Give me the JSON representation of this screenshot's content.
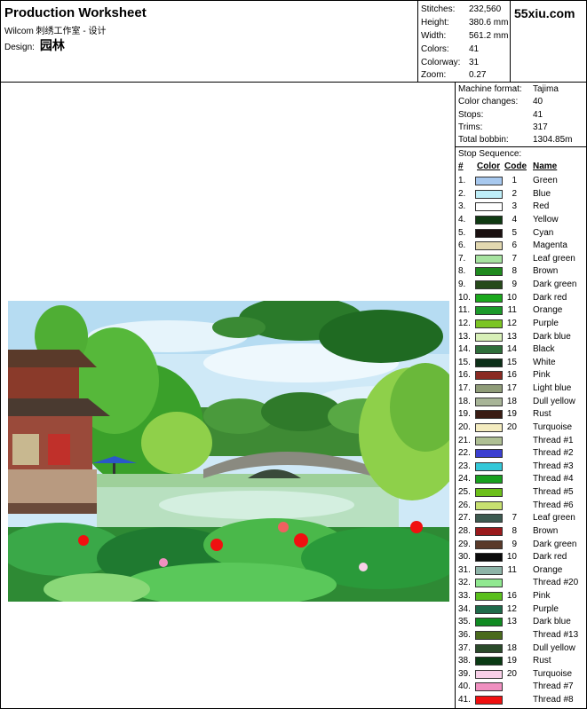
{
  "header": {
    "title": "Production Worksheet",
    "subtitle": "Wilcom 刺绣工作室 - 设计",
    "design_label": "Design:",
    "design_name": "园林",
    "site": "55xiu.com"
  },
  "stats": [
    {
      "label": "Stitches:",
      "value": "232,560"
    },
    {
      "label": "Height:",
      "value": "380.6 mm"
    },
    {
      "label": "Width:",
      "value": "561.2 mm"
    },
    {
      "label": "Colors:",
      "value": "41"
    },
    {
      "label": "Colorway:",
      "value": "31"
    },
    {
      "label": "Zoom:",
      "value": "0.27"
    }
  ],
  "machine": [
    {
      "label": "Machine format:",
      "value": "Tajima"
    },
    {
      "label": "Color changes:",
      "value": "40"
    },
    {
      "label": "Stops:",
      "value": "41"
    },
    {
      "label": "Trims:",
      "value": "317"
    },
    {
      "label": "Total bobbin:",
      "value": "1304.85m"
    }
  ],
  "stop_sequence": {
    "title": "Stop Sequence:",
    "headers": {
      "num": "#",
      "color": "Color",
      "code": "Code",
      "name": "Name"
    },
    "rows": [
      {
        "num": "1.",
        "color": "#a7c8ee",
        "code": "1",
        "name": "Green"
      },
      {
        "num": "2.",
        "color": "#bfeef8",
        "code": "2",
        "name": "Blue"
      },
      {
        "num": "3.",
        "color": "#ffffff",
        "code": "3",
        "name": "Red"
      },
      {
        "num": "4.",
        "color": "#0f3a12",
        "code": "4",
        "name": "Yellow"
      },
      {
        "num": "5.",
        "color": "#1a1010",
        "code": "5",
        "name": "Cyan"
      },
      {
        "num": "6.",
        "color": "#e2d8b0",
        "code": "6",
        "name": "Magenta"
      },
      {
        "num": "7.",
        "color": "#a6e3a0",
        "code": "7",
        "name": "Leaf green"
      },
      {
        "num": "8.",
        "color": "#1f8a1e",
        "code": "8",
        "name": "Brown"
      },
      {
        "num": "9.",
        "color": "#264a1a",
        "code": "9",
        "name": "Dark green"
      },
      {
        "num": "10.",
        "color": "#1aa81c",
        "code": "10",
        "name": "Dark red"
      },
      {
        "num": "11.",
        "color": "#1c9a2a",
        "code": "11",
        "name": "Orange"
      },
      {
        "num": "12.",
        "color": "#7bc423",
        "code": "12",
        "name": "Purple"
      },
      {
        "num": "13.",
        "color": "#d8f0b8",
        "code": "13",
        "name": "Dark blue"
      },
      {
        "num": "14.",
        "color": "#2e6e3a",
        "code": "14",
        "name": "Black"
      },
      {
        "num": "15.",
        "color": "#0c3018",
        "code": "15",
        "name": "White"
      },
      {
        "num": "16.",
        "color": "#8a2a22",
        "code": "16",
        "name": "Pink"
      },
      {
        "num": "17.",
        "color": "#8f9c78",
        "code": "17",
        "name": "Light blue"
      },
      {
        "num": "18.",
        "color": "#a7b497",
        "code": "18",
        "name": "Dull yellow"
      },
      {
        "num": "19.",
        "color": "#3a1c14",
        "code": "19",
        "name": "Rust"
      },
      {
        "num": "20.",
        "color": "#f4ecc0",
        "code": "20",
        "name": "Turquoise"
      },
      {
        "num": "21.",
        "color": "#aebf94",
        "code": "",
        "name": "Thread #1"
      },
      {
        "num": "22.",
        "color": "#3b3fd0",
        "code": "",
        "name": "Thread #2"
      },
      {
        "num": "23.",
        "color": "#34c8d8",
        "code": "",
        "name": "Thread #3"
      },
      {
        "num": "24.",
        "color": "#18a01e",
        "code": "",
        "name": "Thread #4"
      },
      {
        "num": "25.",
        "color": "#6cbf1a",
        "code": "",
        "name": "Thread #5"
      },
      {
        "num": "26.",
        "color": "#c8e070",
        "code": "",
        "name": "Thread #6"
      },
      {
        "num": "27.",
        "color": "#3c5a50",
        "code": "7",
        "name": "Leaf green"
      },
      {
        "num": "28.",
        "color": "#9a1a1c",
        "code": "8",
        "name": "Brown"
      },
      {
        "num": "29.",
        "color": "#5a3a2a",
        "code": "9",
        "name": "Dark green"
      },
      {
        "num": "30.",
        "color": "#0a0a0a",
        "code": "10",
        "name": "Dark red"
      },
      {
        "num": "31.",
        "color": "#8eb4a8",
        "code": "11",
        "name": "Orange"
      },
      {
        "num": "32.",
        "color": "#90e890",
        "code": "",
        "name": "Thread #20"
      },
      {
        "num": "33.",
        "color": "#5abf1c",
        "code": "16",
        "name": "Pink"
      },
      {
        "num": "34.",
        "color": "#1e6a4a",
        "code": "12",
        "name": "Purple"
      },
      {
        "num": "35.",
        "color": "#108a22",
        "code": "13",
        "name": "Dark blue"
      },
      {
        "num": "36.",
        "color": "#4a6a1c",
        "code": "",
        "name": "Thread #13"
      },
      {
        "num": "37.",
        "color": "#2a4a2a",
        "code": "18",
        "name": "Dull yellow"
      },
      {
        "num": "38.",
        "color": "#0a3a14",
        "code": "19",
        "name": "Rust"
      },
      {
        "num": "39.",
        "color": "#f8d0e8",
        "code": "20",
        "name": "Turquoise"
      },
      {
        "num": "40.",
        "color": "#f090c0",
        "code": "",
        "name": "Thread #7"
      },
      {
        "num": "41.",
        "color": "#f01010",
        "code": "",
        "name": "Thread #8"
      }
    ]
  }
}
